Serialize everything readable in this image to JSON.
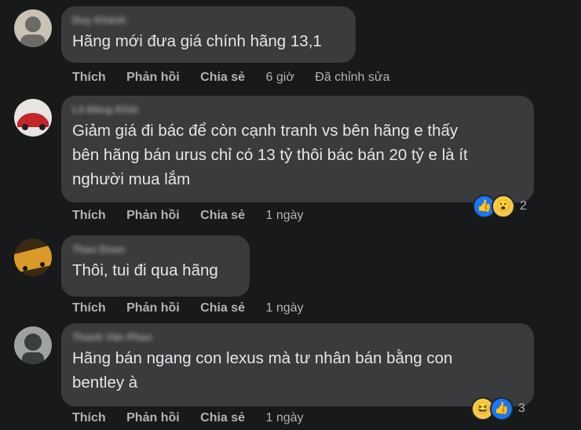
{
  "comments": [
    {
      "author": "Duy Khánh",
      "text": "Hãng mới đưa giá chính hãng 13,1",
      "actions": {
        "like": "Thích",
        "reply": "Phản hồi",
        "share": "Chia sẻ",
        "time": "6 giờ",
        "edited": "Đã chỉnh sửa"
      },
      "avatar_colors": [
        "#c9c2b5",
        "#6c6a66"
      ]
    },
    {
      "author": "Lê Đăng Khôi",
      "text": "Giảm giá đi bác để còn cạnh tranh vs bên hãng e thấy\nbên hãng bán urus chỉ có 13 tỷ thôi bác bán 20 tỷ e là ít\nnghười mua lắm",
      "actions": {
        "like": "Thích",
        "reply": "Phản hồi",
        "share": "Chia sẻ",
        "time": "1 ngày"
      },
      "reactions": {
        "icons": [
          "like-icon",
          "wow-icon"
        ],
        "count": "2"
      },
      "avatar_colors": [
        "#c0262a",
        "#e8e4e0"
      ]
    },
    {
      "author": "Thao Doan",
      "text": "Thôi, tui đi qua hãng",
      "actions": {
        "like": "Thích",
        "reply": "Phản hồi",
        "share": "Chia sẻ",
        "time": "1 ngày"
      },
      "avatar_colors": [
        "#d99a2b",
        "#3a2a12"
      ]
    },
    {
      "author": "Thanh Văn Phan",
      "text": "Hãng bán ngang con lexus mà tư nhân bán bằng con\nbentley à",
      "actions": {
        "like": "Thích",
        "reply": "Phản hồi",
        "share": "Chia sẻ",
        "time": "1 ngày"
      },
      "reactions": {
        "icons": [
          "haha-icon",
          "like-icon"
        ],
        "count": "3"
      },
      "avatar_colors": [
        "#9fa3a0",
        "#3b3f3c"
      ]
    }
  ],
  "colors": {
    "background": "#18191a",
    "bubble": "#3a3b3c",
    "text": "#e4e6eb",
    "muted": "#b0b3b8",
    "like_blue": "#1877f2",
    "emoji_yellow": "#f7c94b"
  }
}
